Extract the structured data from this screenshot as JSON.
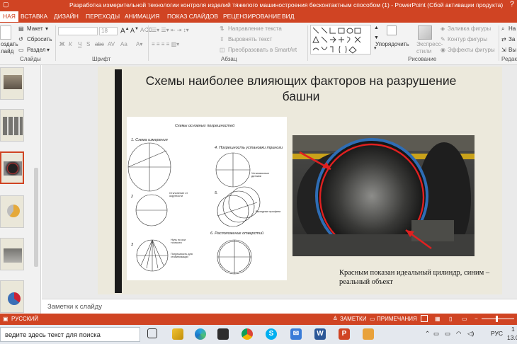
{
  "window": {
    "title": "Разработка измерительной технологии контроля изделий тяжелого машиностроения бесконтактным способом (1) - PowerPoint (Сбой активации продукта)",
    "help": "?"
  },
  "tabs": [
    "НАЯ",
    "ВСТАВКА",
    "ДИЗАЙН",
    "ПЕРЕХОДЫ",
    "АНИМАЦИЯ",
    "ПОКАЗ СЛАЙДОВ",
    "РЕЦЕНЗИРОВАНИЕ",
    "ВИД"
  ],
  "ribbon": {
    "slides": {
      "create": "оздать",
      "create2": "лайд",
      "layout": "Макет",
      "reset": "Сбросить",
      "section": "Раздел",
      "group": "Слайды"
    },
    "font": {
      "size": "18",
      "group": "Шрифт",
      "bold": "Ж",
      "italic": "К",
      "underline": "Ч",
      "strike": "S",
      "shadow": "abc",
      "spacing": "AV",
      "case": "Aa"
    },
    "paragraph": {
      "text_direction": "Направление текста",
      "align_text": "Выровнять текст",
      "smartart": "Преобразовать в SmartArt",
      "group": "Абзац"
    },
    "drawing": {
      "arrange": "Упорядочить",
      "quick_styles": "Экспресс-",
      "quick_styles2": "стили",
      "fill": "Заливка фигуры",
      "outline": "Контур фигуры",
      "effects": "Эффекты фигуры",
      "group": "Рисование"
    },
    "editing": {
      "find": "На",
      "replace": "За",
      "select": "Вы",
      "group": "Редак"
    }
  },
  "slide": {
    "title": "Схемы наиболее влияющих   факторов на разрушение башни",
    "caption": "Красным показан идеальный цилиндр, синим – реальный объект"
  },
  "scheme": {
    "heading": "Схемы основных погрешностей",
    "items": [
      "1. Схема измерения",
      "4. Погрешность установки триноги",
      "2",
      "5.",
      "3",
      "6. Расположение отверстий"
    ],
    "notes": [
      "Отклонение от округлости",
      "Установочные датчики",
      "Выходные профили",
      "Нуль по оси точности",
      "Погрешность для стабилизации"
    ]
  },
  "notes_placeholder": "Заметки к слайду",
  "status": {
    "language": "РУССКИЙ",
    "notes": "ЗАМЕТКИ",
    "comments": "ПРИМЕЧАНИЯ"
  },
  "taskbar": {
    "search_placeholder": "ведите здесь текст для поиска",
    "lang": "РУС",
    "time": "1",
    "date": "13.0"
  },
  "colors": {
    "accent": "#d04423",
    "taskbar": "#e4e8ee"
  }
}
